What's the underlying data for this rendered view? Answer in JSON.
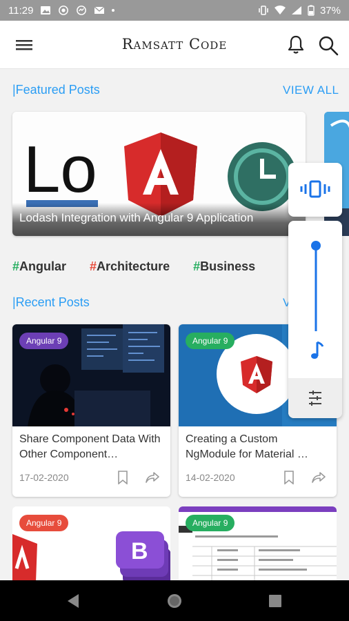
{
  "status_bar": {
    "time": "11:29",
    "battery": "37%"
  },
  "app": {
    "title": "Ramsatt Code"
  },
  "featured": {
    "section_title": "|Featured Posts",
    "view_all": "VIEW ALL",
    "card": {
      "caption": "Lodash Integration with Angular 9 Application",
      "logo_text": "Lo"
    }
  },
  "tags": [
    {
      "hash": "#",
      "label": "Angular",
      "color": "#27ae60"
    },
    {
      "hash": "#",
      "label": "Architecture",
      "color": "#e74c3c"
    },
    {
      "hash": "#",
      "label": "Business",
      "color": "#27ae60"
    }
  ],
  "recent": {
    "section_title": "|Recent Posts",
    "view_all_partial": "V",
    "posts": [
      {
        "badge": "Angular 9",
        "badge_color": "#6c3fb5",
        "title": "Share Component Data With Other Component…",
        "date": "17-02-2020"
      },
      {
        "badge": "Angular 9",
        "badge_color": "#27ae60",
        "title": "Creating a Custom NgModule for Material …",
        "date": "14-02-2020"
      },
      {
        "badge": "Angular 9",
        "badge_color": "#e74c3c"
      },
      {
        "badge": "Angular 9",
        "badge_color": "#27ae60"
      }
    ]
  },
  "colors": {
    "accent": "#2a9df4",
    "volume_accent": "#1a73e8"
  },
  "volume": {
    "level": 1.0
  }
}
